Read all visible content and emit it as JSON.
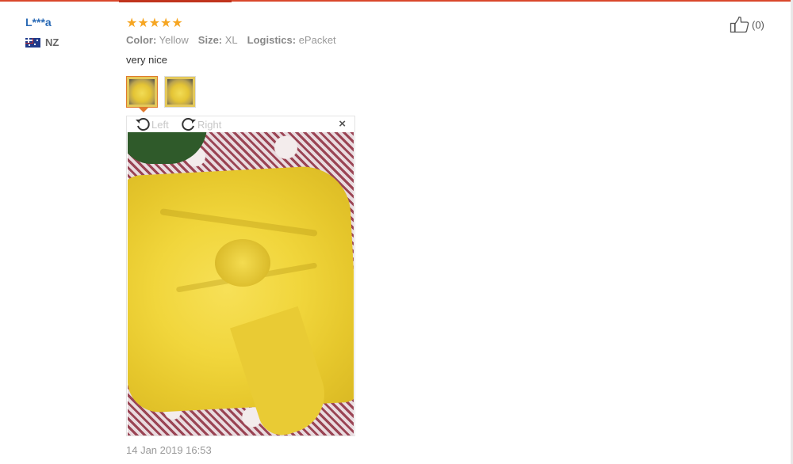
{
  "reviewer": {
    "name": "L***a",
    "country": "NZ"
  },
  "rating": {
    "stars": 5,
    "max": 5
  },
  "properties": [
    {
      "label": "Color:",
      "value": "Yellow"
    },
    {
      "label": "Size:",
      "value": "XL"
    },
    {
      "label": "Logistics:",
      "value": "ePacket"
    }
  ],
  "review_text": "very nice",
  "photos": {
    "count": 2,
    "selected": 1
  },
  "viewer": {
    "rotate_left_label": "Left",
    "rotate_right_label": "Right",
    "close_label": "×"
  },
  "timestamp": "14 Jan 2019 16:53",
  "helpful": {
    "count": "(0)"
  },
  "colors": {
    "accent": "#d9472b",
    "star": "#f6a623",
    "username": "#2a6ab5"
  }
}
